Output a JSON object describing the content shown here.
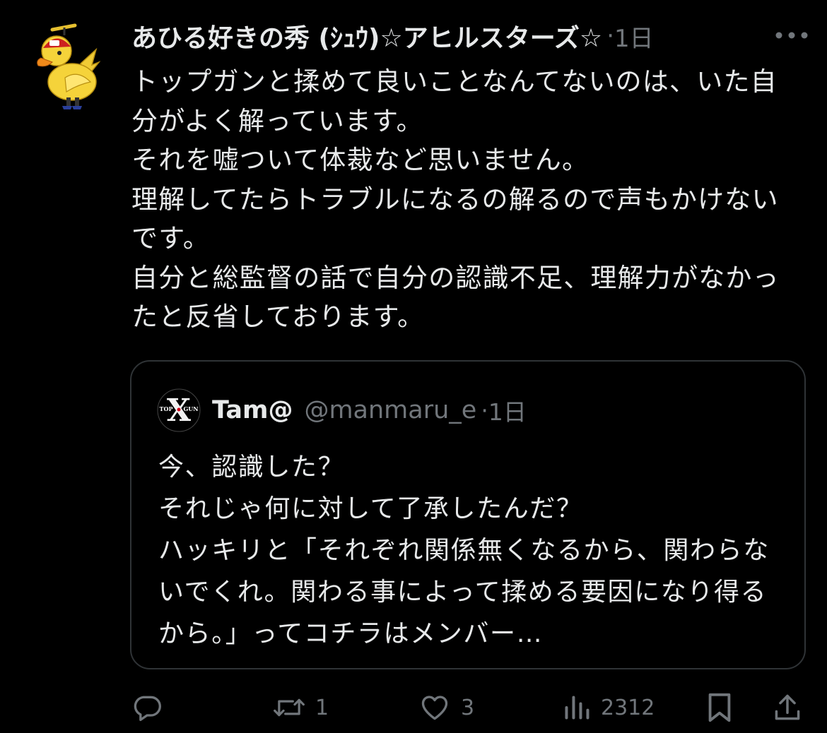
{
  "tweet": {
    "display_name": "あひる好きの秀 (ｼｭｳ)☆アヒルスターズ☆",
    "separator": "·",
    "time": "1日",
    "text": "トップガンと揉めて良いことなんてないのは、いた自分がよく解っています。\nそれを嘘ついて体裁など思いません。\n理解してたらトラブルになるの解るので声もかけないです。\n自分と総監督の話で自分の認識不足、理解力がなかったと反省しております。"
  },
  "quote": {
    "display_name": "Tam@",
    "handle": "@manmaru_e",
    "separator": "·",
    "time": "1日",
    "avatar_text": [
      "TOP",
      "GUN",
      "X"
    ],
    "text": "今、認識した？\nそれじゃ何に対して了承したんだ？\nハッキリと「それぞれ関係無くなるから、関わらないでくれ。関わる事によって揉める要因になり得るから。」ってコチラはメンバー…"
  },
  "actions": {
    "reply_count": "",
    "retweet_count": "1",
    "like_count": "3",
    "views_count": "2312"
  },
  "icons": {
    "more": "more-icon",
    "reply": "reply-icon",
    "retweet": "retweet-icon",
    "like": "heart-icon",
    "views": "views-icon",
    "bookmark": "bookmark-icon",
    "share": "share-icon"
  },
  "colors": {
    "background": "#000000",
    "text": "#e7e9ea",
    "secondary": "#71767b",
    "border": "#2f3336",
    "avatar_yellow": "#f5d33a",
    "topgun_red": "#d0021b"
  }
}
